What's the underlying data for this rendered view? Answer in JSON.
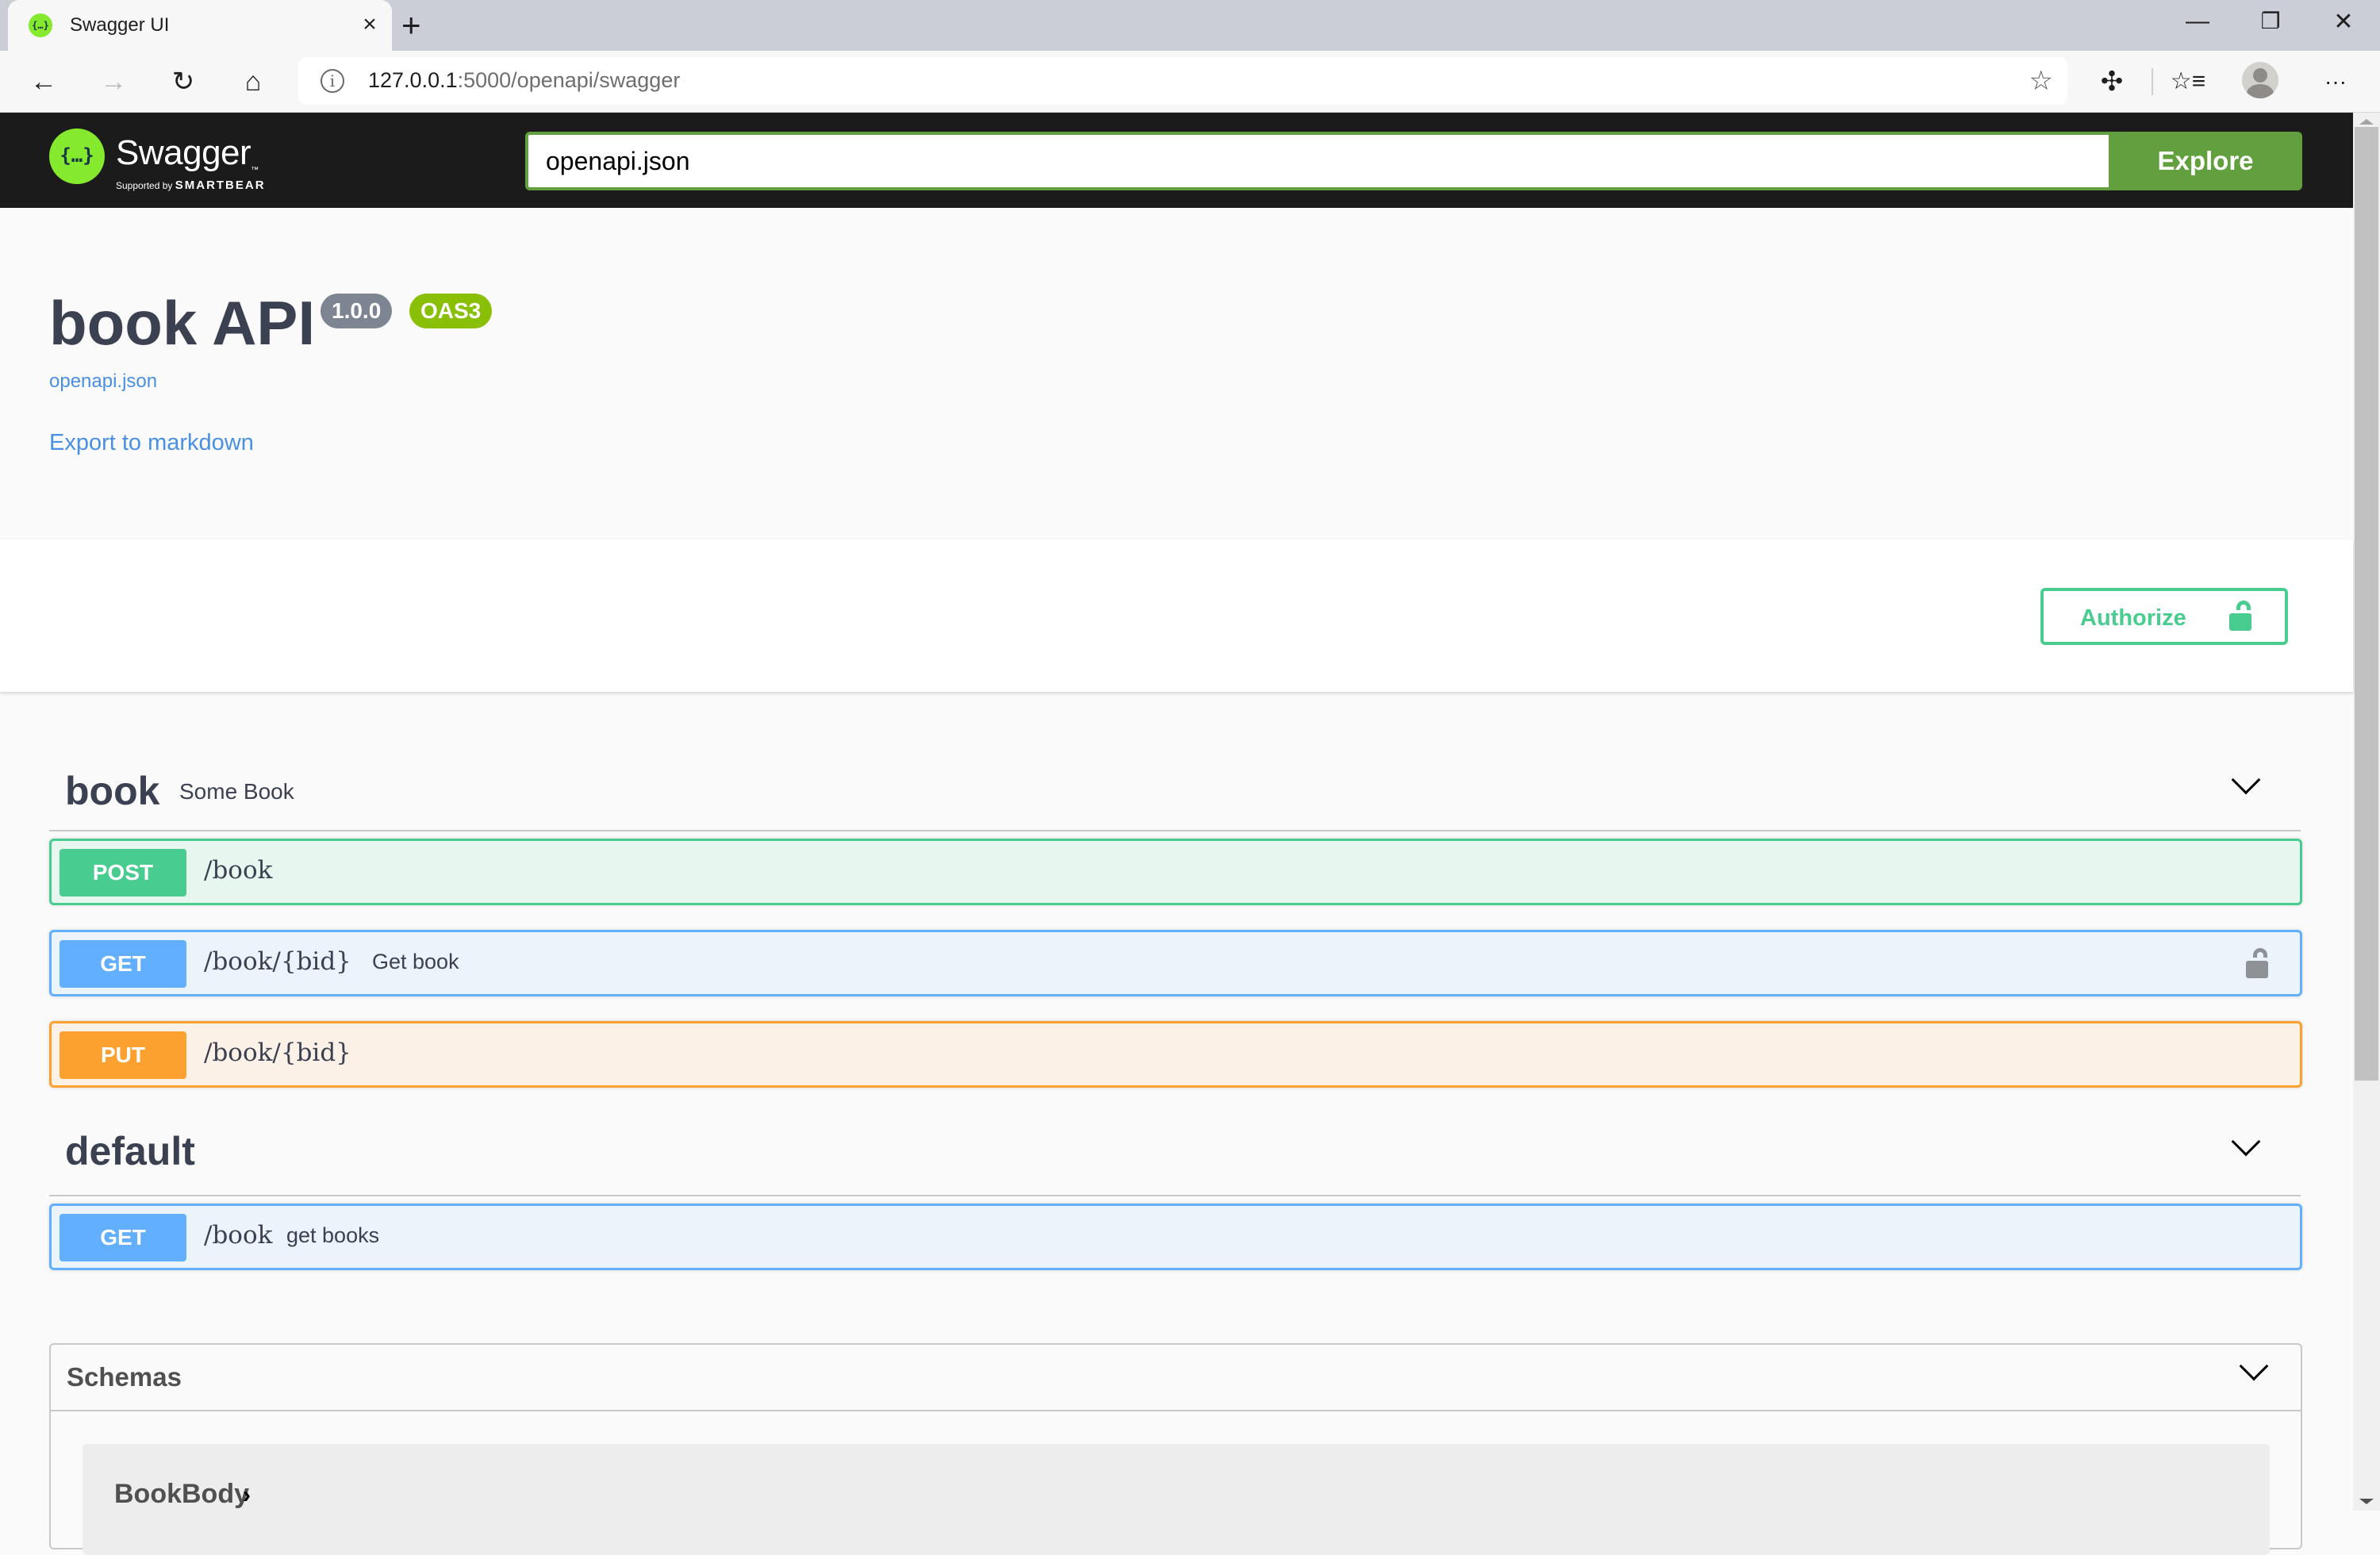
{
  "browser": {
    "tab_title": "Swagger UI",
    "tab_close_glyph": "×",
    "new_tab_glyph": "+",
    "url_host": "127.0.0.1",
    "url_rest": ":5000/openapi/swagger",
    "window_controls": {
      "minimize": "—",
      "restore": "❐",
      "close": "✕"
    },
    "nav": {
      "back": "←",
      "forward": "→",
      "reload": "↻",
      "home": "⌂"
    },
    "toolbar_icons": {
      "add_favorite": "☆",
      "extensions": "✣",
      "favorites": "☆≡",
      "more": "···"
    },
    "info_glyph": "i"
  },
  "topbar": {
    "logo_glyph": "{…}",
    "logo_text": "Swagger",
    "logo_tm": "™",
    "logo_sub_prefix": "Supported by",
    "logo_sub_brand": "SMARTBEAR",
    "url_input_value": "openapi.json",
    "explore_label": "Explore"
  },
  "info": {
    "title": "book API",
    "version": "1.0.0",
    "oas_badge": "OAS3",
    "spec_link": "openapi.json",
    "export_link": "Export to markdown"
  },
  "schemes": {
    "authorize_label": "Authorize"
  },
  "tags": [
    {
      "name": "book",
      "description": "Some Book",
      "operations": [
        {
          "method": "POST",
          "path": "/book",
          "summary": "",
          "locked": false
        },
        {
          "method": "GET",
          "path": "/book/{bid}",
          "summary": "Get book",
          "locked": true
        },
        {
          "method": "PUT",
          "path": "/book/{bid}",
          "summary": "",
          "locked": false
        }
      ]
    },
    {
      "name": "default",
      "description": "",
      "operations": [
        {
          "method": "GET",
          "path": "/book",
          "summary": "get books",
          "locked": false
        }
      ]
    }
  ],
  "schemas": {
    "title": "Schemas",
    "models": [
      {
        "name": "BookBody",
        "expand_glyph": "›"
      }
    ]
  },
  "colors": {
    "post": "#49cc90",
    "get": "#61affe",
    "put": "#fca130",
    "swagger_green": "#62a03f",
    "topbar_bg": "#1b1b1b",
    "link": "#4990e2",
    "text": "#3b4151"
  }
}
